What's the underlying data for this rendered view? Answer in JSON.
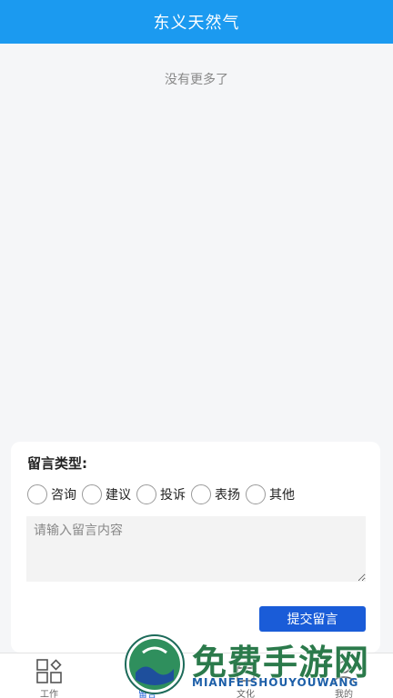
{
  "header": {
    "title": "东义天然气"
  },
  "list": {
    "empty_text": "没有更多了"
  },
  "form": {
    "type_title": "留言类型:",
    "options": [
      "咨询",
      "建议",
      "投诉",
      "表扬",
      "其他"
    ],
    "textarea_placeholder": "请输入留言内容",
    "submit_label": "提交留言"
  },
  "tabbar": {
    "items": [
      {
        "label": "工作",
        "icon": "grid-icon"
      },
      {
        "label": "留言",
        "icon": "message-icon"
      },
      {
        "label": "文化",
        "icon": "culture-icon"
      },
      {
        "label": "我的",
        "icon": "user-icon"
      }
    ],
    "active_index": 1
  },
  "watermark": {
    "text": "免费手游网",
    "subtext": "MIANFEISHOUYOUWANG"
  },
  "colors": {
    "header": "#1b9af0",
    "accent": "#1a5cd8",
    "background": "#f5f6f8"
  }
}
